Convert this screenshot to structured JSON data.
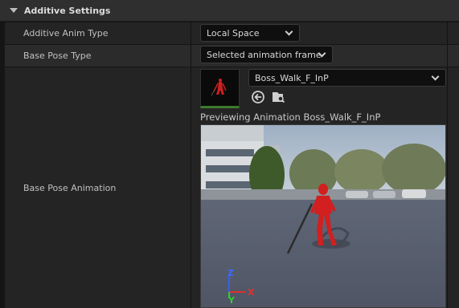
{
  "section": {
    "title": "Additive Settings"
  },
  "rows": [
    {
      "label": "Additive Anim Type",
      "value": "Local Space"
    },
    {
      "label": "Base Pose Type",
      "value": "Selected animation frame"
    },
    {
      "label": "Base Pose Animation"
    }
  ],
  "asset": {
    "name": "Boss_Walk_F_InP"
  },
  "preview": {
    "caption": "Previewing Animation Boss_Walk_F_InP"
  },
  "axes": {
    "z": "Z",
    "x": "X",
    "y": "Y"
  },
  "colors": {
    "thumbnail_bar": "#3d7a2c",
    "character": "#d21f1f",
    "axis_x": "#e03030",
    "axis_y": "#30d030",
    "axis_z": "#3060ff"
  },
  "icons": {
    "section_toggle": "triangle-down-icon",
    "use_selected": "arrow-left-circle-icon",
    "browse": "folder-search-icon"
  }
}
